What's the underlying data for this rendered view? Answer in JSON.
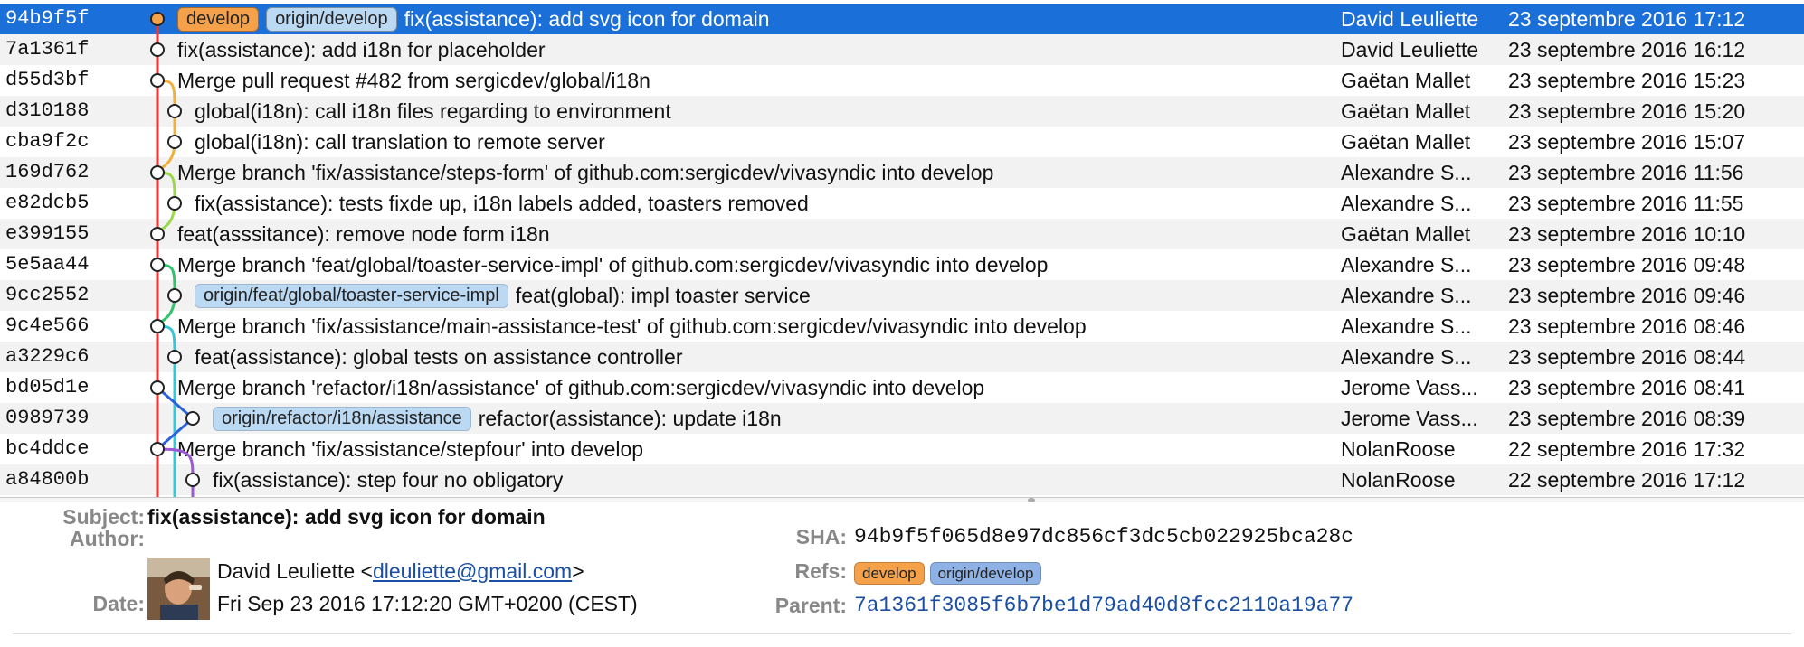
{
  "commits": [
    {
      "sha": "94b9f5f",
      "refs": [
        {
          "label": "develop",
          "kind": "branch"
        },
        {
          "label": "origin/develop",
          "kind": "remote"
        }
      ],
      "subject": "fix(assistance): add svg icon for domain",
      "author": "David Leuliette",
      "date": "23 septembre 2016 17:12"
    },
    {
      "sha": "7a1361f",
      "refs": [],
      "subject": "fix(assistance): add i18n for placeholder",
      "author": "David Leuliette",
      "date": "23 septembre 2016 16:12"
    },
    {
      "sha": "d55d3bf",
      "refs": [],
      "subject": "Merge pull request #482 from sergicdev/global/i18n",
      "author": "Gaëtan Mallet",
      "date": "23 septembre 2016 15:23"
    },
    {
      "sha": "d310188",
      "refs": [],
      "subject": "global(i18n): call i18n files regarding to environment",
      "author": "Gaëtan Mallet",
      "date": "23 septembre 2016 15:20"
    },
    {
      "sha": "cba9f2c",
      "refs": [],
      "subject": "global(i18n): call translation to remote server",
      "author": "Gaëtan Mallet",
      "date": "23 septembre 2016 15:07"
    },
    {
      "sha": "169d762",
      "refs": [],
      "subject": "Merge branch 'fix/assistance/steps-form' of github.com:sergicdev/vivasyndic into develop",
      "author": "Alexandre S...",
      "date": "23 septembre 2016 11:56"
    },
    {
      "sha": "e82dcb5",
      "refs": [],
      "subject": "fix(assistance): tests fixde up, i18n labels added, toasters removed",
      "author": "Alexandre S...",
      "date": "23 septembre 2016 11:55"
    },
    {
      "sha": "e399155",
      "refs": [],
      "subject": "feat(asssitance): remove node form i18n",
      "author": "Gaëtan Mallet",
      "date": "23 septembre 2016 10:10"
    },
    {
      "sha": "5e5aa44",
      "refs": [],
      "subject": "Merge branch 'feat/global/toaster-service-impl' of github.com:sergicdev/vivasyndic into develop",
      "author": "Alexandre S...",
      "date": "23 septembre 2016 09:48"
    },
    {
      "sha": "9cc2552",
      "refs": [
        {
          "label": "origin/feat/global/toaster-service-impl",
          "kind": "remote"
        }
      ],
      "subject": "feat(global): impl toaster service",
      "author": "Alexandre S...",
      "date": "23 septembre 2016 09:46"
    },
    {
      "sha": "9c4e566",
      "refs": [],
      "subject": "Merge branch 'fix/assistance/main-assistance-test' of github.com:sergicdev/vivasyndic into develop",
      "author": "Alexandre S...",
      "date": "23 septembre 2016 08:46"
    },
    {
      "sha": "a3229c6",
      "refs": [],
      "subject": "feat(assistance): global tests on assistance controller",
      "author": "Alexandre S...",
      "date": "23 septembre 2016 08:44"
    },
    {
      "sha": "bd05d1e",
      "refs": [],
      "subject": "Merge branch 'refactor/i18n/assistance' of github.com:sergicdev/vivasyndic into develop",
      "author": "Jerome Vass...",
      "date": "23 septembre 2016 08:41"
    },
    {
      "sha": "0989739",
      "refs": [
        {
          "label": "origin/refactor/i18n/assistance",
          "kind": "remote"
        }
      ],
      "subject": "refactor(assistance): update i18n",
      "author": "Jerome Vass...",
      "date": "23 septembre 2016 08:39"
    },
    {
      "sha": "bc4ddce",
      "refs": [],
      "subject": "Merge branch 'fix/assistance/stepfour' into develop",
      "author": "NolanRoose",
      "date": "22 septembre 2016 17:32"
    },
    {
      "sha": "a84800b",
      "refs": [],
      "subject": "fix(assistance): step four no obligatory",
      "author": "NolanRoose",
      "date": "22 septembre 2016 17:12"
    }
  ],
  "graph": {
    "lanes": [
      0,
      0,
      0,
      1,
      1,
      0,
      1,
      0,
      0,
      1,
      0,
      1,
      0,
      2,
      0,
      2
    ],
    "colors": {
      "main": "#e03a3a",
      "i18n": "#f0b040",
      "steps_form": "#9bd84a",
      "toaster": "#2fc46a",
      "main_test": "#39c6d6",
      "refactor": "#2b62d9",
      "stepfour": "#9b59d6",
      "head_node": "#f5a14a"
    }
  },
  "details": {
    "subject_label": "Subject:",
    "subject": "fix(assistance): add svg icon for domain",
    "author_label": "Author:",
    "author_name": "David Leuliette <",
    "author_email": "dleuliette@gmail.com",
    "author_close": ">",
    "date_label": "Date:",
    "date": "Fri Sep 23 2016 17:12:20 GMT+0200 (CEST)",
    "sha_label": "SHA:",
    "sha": "94b9f5f065d8e97dc856cf3dc5cb022925bca28c",
    "refs_label": "Refs:",
    "refs": [
      {
        "label": "develop",
        "kind": "branch"
      },
      {
        "label": "origin/develop",
        "kind": "remote"
      }
    ],
    "parent_label": "Parent:",
    "parent": "7a1361f3085f6b7be1d79ad40d8fcc2110a19a77"
  }
}
